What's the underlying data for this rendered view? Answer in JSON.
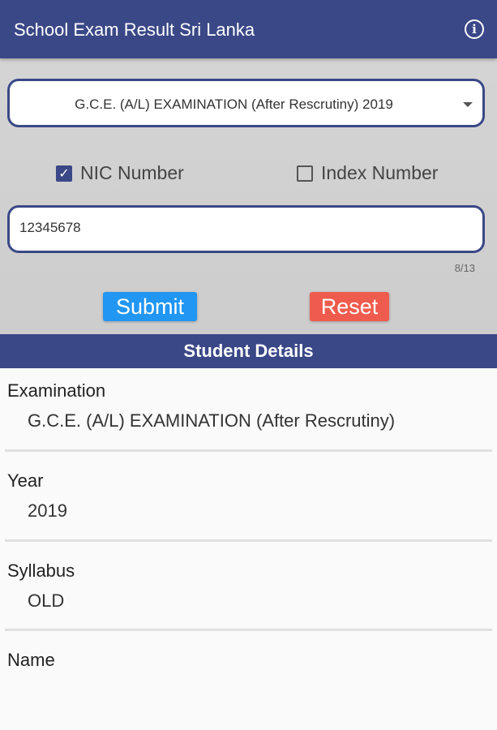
{
  "appbar": {
    "title": "School Exam Result Sri Lanka",
    "info_icon": "info-icon"
  },
  "form": {
    "exam_select_value": "G.C.E. (A/L) EXAMINATION (After Rescrutiny) 2019",
    "nic_checkbox": {
      "label": "NIC Number",
      "checked": true
    },
    "index_checkbox": {
      "label": "Index Number",
      "checked": false
    },
    "input_value": "12345678",
    "char_counter": "8/13",
    "submit_label": "Submit",
    "reset_label": "Reset"
  },
  "details": {
    "header": "Student Details",
    "items": [
      {
        "label": "Examination",
        "value": "G.C.E. (A/L) EXAMINATION (After Rescrutiny)"
      },
      {
        "label": "Year",
        "value": "2019"
      },
      {
        "label": "Syllabus",
        "value": "OLD"
      },
      {
        "label": "Name",
        "value": ""
      }
    ]
  },
  "colors": {
    "primary": "#3a4887",
    "submit": "#2196f3",
    "reset": "#ef5b4c",
    "form_bg": "#d4d4d4"
  }
}
